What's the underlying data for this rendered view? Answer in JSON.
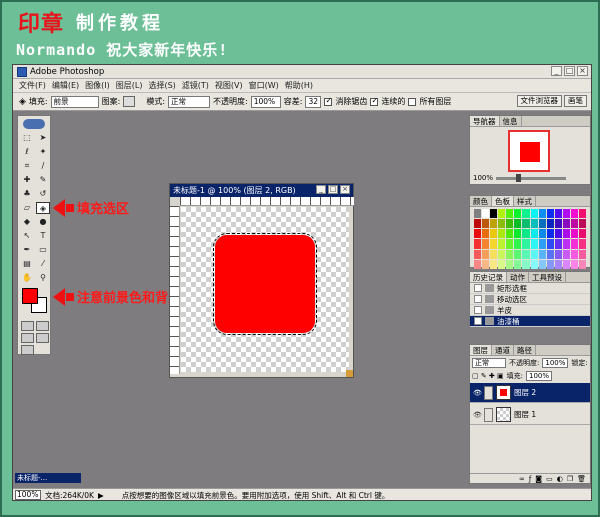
{
  "banner": {
    "title_part1": "印章",
    "title_part2": "制作教程",
    "subtitle": "Normando 祝大家新年快乐!"
  },
  "app": {
    "window_title": "Adobe Photoshop",
    "menu": [
      "文件(F)",
      "编辑(E)",
      "图像(I)",
      "图层(L)",
      "选择(S)",
      "滤镜(T)",
      "视图(V)",
      "窗口(W)",
      "帮助(H)"
    ]
  },
  "options": {
    "fill_label": "填充:",
    "fill_value": "前景",
    "pattern_label": "图案:",
    "mode_label": "模式:",
    "mode_value": "正常",
    "opacity_label": "不透明度:",
    "opacity_value": "100%",
    "tolerance_label": "容差:",
    "tolerance_value": "32",
    "antialias_label": "消除锯齿",
    "contiguous_label": "连续的",
    "all_layers_label": "所有图层",
    "well_tabs": [
      "文件浏览器",
      "画笔"
    ]
  },
  "annotations": {
    "fill_selection": "填充选区",
    "note_colors": "注意前景色和背景色"
  },
  "colors": {
    "accent_red": "#ff0000",
    "annotation_red": "#ee1111",
    "selected_blue": "#0a246a"
  },
  "document": {
    "title": "未标题-1 @ 100% (图层 2, RGB)"
  },
  "navigator": {
    "tabs": [
      "导航器",
      "信息"
    ],
    "zoom": "100%"
  },
  "swatches": {
    "tabs": [
      "颜色",
      "色板",
      "样式"
    ]
  },
  "history": {
    "tabs": [
      "历史记录",
      "动作",
      "工具预设"
    ],
    "items": [
      "矩形选框",
      "移动选区",
      "羊皮",
      "油漆桶"
    ]
  },
  "layers": {
    "tabs": [
      "图层",
      "通道",
      "路径"
    ],
    "mode_value": "正常",
    "opacity_label": "不透明度:",
    "opacity_value": "100%",
    "lock_label": "锁定:",
    "fill_label": "填充:",
    "fill_value": "100%",
    "rows": [
      "图层 2",
      "图层 1"
    ]
  },
  "minimized": {
    "title": "未标题-..."
  },
  "status": {
    "zoom": "100%",
    "doc_info": "文档:264K/0K",
    "tip": "点按想要的图像区域以填充前景色。要用附加选项，使用 Shift、Alt 和 Ctrl 键。"
  }
}
